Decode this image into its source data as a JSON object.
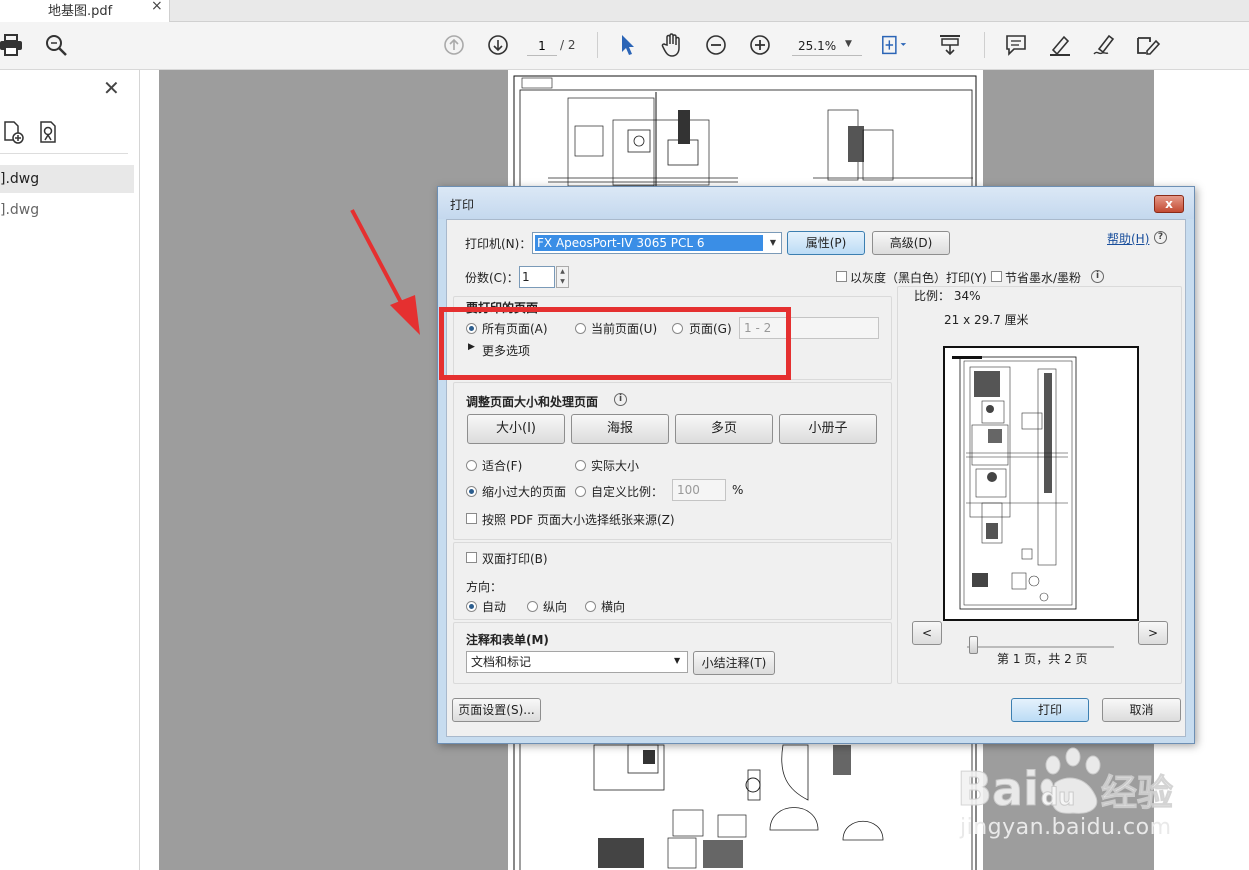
{
  "tab": {
    "title": "地基图.pdf",
    "close": "×"
  },
  "toolbar": {
    "page_current": "1",
    "page_total": "/ 2",
    "zoom": "25.1%"
  },
  "left_panel": {
    "close": "✕",
    "items": [
      "].dwg",
      "].dwg"
    ]
  },
  "dialog": {
    "title": "打印",
    "close": "x",
    "printer_label": "打印机(N)：",
    "printer_value": "FX ApeosPort-IV 3065 PCL 6",
    "properties_button": "属性(P)",
    "advanced_button": "高级(D)",
    "help_link": "帮助(H)",
    "copies_label": "份数(C)：",
    "copies_value": "1",
    "grayscale_label": "以灰度（黑白色）打印(Y)",
    "save_ink_label": "节省墨水/墨粉",
    "pages_section": {
      "title": "要打印的页面",
      "all_pages": "所有页面(A)",
      "current_page": "当前页面(U)",
      "pages": "页面(G)",
      "pages_value": "1 - 2",
      "more_options": "更多选项"
    },
    "sizing_section": {
      "title": "调整页面大小和处理页面",
      "tabs": [
        "大小(I)",
        "海报",
        "多页",
        "小册子"
      ],
      "fit": "适合(F)",
      "actual_size": "实际大小",
      "shrink": "缩小过大的页面",
      "custom_scale": "自定义比例：",
      "custom_scale_value": "100",
      "percent": "%",
      "choose_paper": "按照 PDF 页面大小选择纸张来源(Z)"
    },
    "duplex_label": "双面打印(B)",
    "orientation": {
      "label": "方向：",
      "auto": "自动",
      "portrait": "纵向",
      "landscape": "横向"
    },
    "comments_section": {
      "title": "注释和表单(M)",
      "select_value": "文档和标记",
      "summarize_button": "小结注释(T)"
    },
    "preview": {
      "scale": "比例： 34%",
      "paper_size": "21 x 29.7 厘米",
      "prev": "<",
      "next": ">",
      "page_info": "第 1 页，共 2 页"
    },
    "page_setup_button": "页面设置(S)...",
    "print_button": "打印",
    "cancel_button": "取消"
  },
  "watermark": {
    "text": "jingyan.baidu.com",
    "brand": "Bai经验"
  },
  "colors": {
    "highlight_red": "#e53030",
    "dialog_frame": "#c7dcef",
    "selection_blue": "#3a8ee6"
  }
}
